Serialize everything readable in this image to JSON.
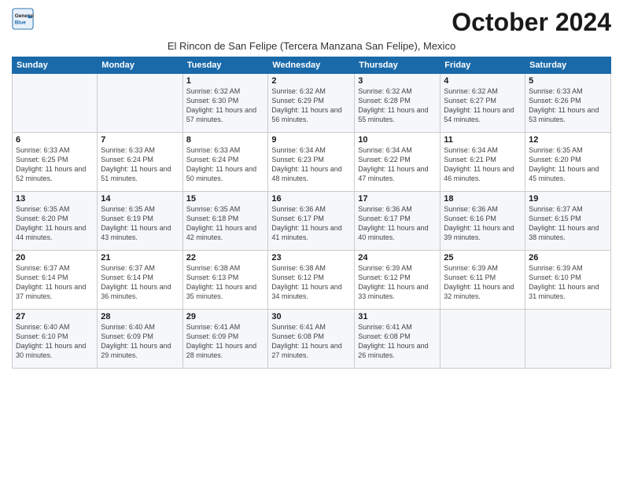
{
  "logo": {
    "line1": "General",
    "line2": "Blue"
  },
  "title": "October 2024",
  "location": "El Rincon de San Felipe (Tercera Manzana San Felipe), Mexico",
  "days_of_week": [
    "Sunday",
    "Monday",
    "Tuesday",
    "Wednesday",
    "Thursday",
    "Friday",
    "Saturday"
  ],
  "weeks": [
    [
      {
        "day": "",
        "sunrise": "",
        "sunset": "",
        "daylight": ""
      },
      {
        "day": "",
        "sunrise": "",
        "sunset": "",
        "daylight": ""
      },
      {
        "day": "1",
        "sunrise": "Sunrise: 6:32 AM",
        "sunset": "Sunset: 6:30 PM",
        "daylight": "Daylight: 11 hours and 57 minutes."
      },
      {
        "day": "2",
        "sunrise": "Sunrise: 6:32 AM",
        "sunset": "Sunset: 6:29 PM",
        "daylight": "Daylight: 11 hours and 56 minutes."
      },
      {
        "day": "3",
        "sunrise": "Sunrise: 6:32 AM",
        "sunset": "Sunset: 6:28 PM",
        "daylight": "Daylight: 11 hours and 55 minutes."
      },
      {
        "day": "4",
        "sunrise": "Sunrise: 6:32 AM",
        "sunset": "Sunset: 6:27 PM",
        "daylight": "Daylight: 11 hours and 54 minutes."
      },
      {
        "day": "5",
        "sunrise": "Sunrise: 6:33 AM",
        "sunset": "Sunset: 6:26 PM",
        "daylight": "Daylight: 11 hours and 53 minutes."
      }
    ],
    [
      {
        "day": "6",
        "sunrise": "Sunrise: 6:33 AM",
        "sunset": "Sunset: 6:25 PM",
        "daylight": "Daylight: 11 hours and 52 minutes."
      },
      {
        "day": "7",
        "sunrise": "Sunrise: 6:33 AM",
        "sunset": "Sunset: 6:24 PM",
        "daylight": "Daylight: 11 hours and 51 minutes."
      },
      {
        "day": "8",
        "sunrise": "Sunrise: 6:33 AM",
        "sunset": "Sunset: 6:24 PM",
        "daylight": "Daylight: 11 hours and 50 minutes."
      },
      {
        "day": "9",
        "sunrise": "Sunrise: 6:34 AM",
        "sunset": "Sunset: 6:23 PM",
        "daylight": "Daylight: 11 hours and 48 minutes."
      },
      {
        "day": "10",
        "sunrise": "Sunrise: 6:34 AM",
        "sunset": "Sunset: 6:22 PM",
        "daylight": "Daylight: 11 hours and 47 minutes."
      },
      {
        "day": "11",
        "sunrise": "Sunrise: 6:34 AM",
        "sunset": "Sunset: 6:21 PM",
        "daylight": "Daylight: 11 hours and 46 minutes."
      },
      {
        "day": "12",
        "sunrise": "Sunrise: 6:35 AM",
        "sunset": "Sunset: 6:20 PM",
        "daylight": "Daylight: 11 hours and 45 minutes."
      }
    ],
    [
      {
        "day": "13",
        "sunrise": "Sunrise: 6:35 AM",
        "sunset": "Sunset: 6:20 PM",
        "daylight": "Daylight: 11 hours and 44 minutes."
      },
      {
        "day": "14",
        "sunrise": "Sunrise: 6:35 AM",
        "sunset": "Sunset: 6:19 PM",
        "daylight": "Daylight: 11 hours and 43 minutes."
      },
      {
        "day": "15",
        "sunrise": "Sunrise: 6:35 AM",
        "sunset": "Sunset: 6:18 PM",
        "daylight": "Daylight: 11 hours and 42 minutes."
      },
      {
        "day": "16",
        "sunrise": "Sunrise: 6:36 AM",
        "sunset": "Sunset: 6:17 PM",
        "daylight": "Daylight: 11 hours and 41 minutes."
      },
      {
        "day": "17",
        "sunrise": "Sunrise: 6:36 AM",
        "sunset": "Sunset: 6:17 PM",
        "daylight": "Daylight: 11 hours and 40 minutes."
      },
      {
        "day": "18",
        "sunrise": "Sunrise: 6:36 AM",
        "sunset": "Sunset: 6:16 PM",
        "daylight": "Daylight: 11 hours and 39 minutes."
      },
      {
        "day": "19",
        "sunrise": "Sunrise: 6:37 AM",
        "sunset": "Sunset: 6:15 PM",
        "daylight": "Daylight: 11 hours and 38 minutes."
      }
    ],
    [
      {
        "day": "20",
        "sunrise": "Sunrise: 6:37 AM",
        "sunset": "Sunset: 6:14 PM",
        "daylight": "Daylight: 11 hours and 37 minutes."
      },
      {
        "day": "21",
        "sunrise": "Sunrise: 6:37 AM",
        "sunset": "Sunset: 6:14 PM",
        "daylight": "Daylight: 11 hours and 36 minutes."
      },
      {
        "day": "22",
        "sunrise": "Sunrise: 6:38 AM",
        "sunset": "Sunset: 6:13 PM",
        "daylight": "Daylight: 11 hours and 35 minutes."
      },
      {
        "day": "23",
        "sunrise": "Sunrise: 6:38 AM",
        "sunset": "Sunset: 6:12 PM",
        "daylight": "Daylight: 11 hours and 34 minutes."
      },
      {
        "day": "24",
        "sunrise": "Sunrise: 6:39 AM",
        "sunset": "Sunset: 6:12 PM",
        "daylight": "Daylight: 11 hours and 33 minutes."
      },
      {
        "day": "25",
        "sunrise": "Sunrise: 6:39 AM",
        "sunset": "Sunset: 6:11 PM",
        "daylight": "Daylight: 11 hours and 32 minutes."
      },
      {
        "day": "26",
        "sunrise": "Sunrise: 6:39 AM",
        "sunset": "Sunset: 6:10 PM",
        "daylight": "Daylight: 11 hours and 31 minutes."
      }
    ],
    [
      {
        "day": "27",
        "sunrise": "Sunrise: 6:40 AM",
        "sunset": "Sunset: 6:10 PM",
        "daylight": "Daylight: 11 hours and 30 minutes."
      },
      {
        "day": "28",
        "sunrise": "Sunrise: 6:40 AM",
        "sunset": "Sunset: 6:09 PM",
        "daylight": "Daylight: 11 hours and 29 minutes."
      },
      {
        "day": "29",
        "sunrise": "Sunrise: 6:41 AM",
        "sunset": "Sunset: 6:09 PM",
        "daylight": "Daylight: 11 hours and 28 minutes."
      },
      {
        "day": "30",
        "sunrise": "Sunrise: 6:41 AM",
        "sunset": "Sunset: 6:08 PM",
        "daylight": "Daylight: 11 hours and 27 minutes."
      },
      {
        "day": "31",
        "sunrise": "Sunrise: 6:41 AM",
        "sunset": "Sunset: 6:08 PM",
        "daylight": "Daylight: 11 hours and 26 minutes."
      },
      {
        "day": "",
        "sunrise": "",
        "sunset": "",
        "daylight": ""
      },
      {
        "day": "",
        "sunrise": "",
        "sunset": "",
        "daylight": ""
      }
    ]
  ]
}
